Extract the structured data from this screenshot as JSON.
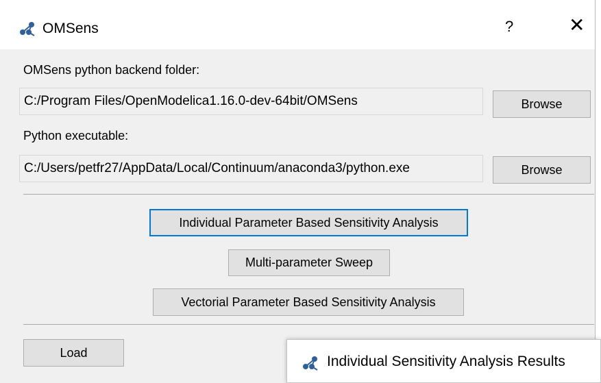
{
  "window": {
    "title": "OMSens",
    "help_label": "?",
    "close_label": "✕",
    "icon": "omsens-logo-icon"
  },
  "backend": {
    "label": "OMSens python backend folder:",
    "value": "C:/Program Files/OpenModelica1.16.0-dev-64bit/OMSens",
    "browse_label": "Browse"
  },
  "python": {
    "label": "Python executable:",
    "value": "C:/Users/petfr27/AppData/Local/Continuum/anaconda3/python.exe",
    "browse_label": "Browse"
  },
  "actions": {
    "individual_label": "Individual Parameter Based Sensitivity Analysis",
    "sweep_label": "Multi-parameter Sweep",
    "vectorial_label": "Vectorial Parameter Based Sensitivity Analysis"
  },
  "footer": {
    "load_label": "Load"
  },
  "results_window": {
    "title": "Individual Sensitivity Analysis Results",
    "icon": "omsens-logo-icon"
  },
  "colors": {
    "focus_border": "#0078d7",
    "dialog_bg": "#f0f0f0",
    "button_bg": "#e1e1e1"
  }
}
